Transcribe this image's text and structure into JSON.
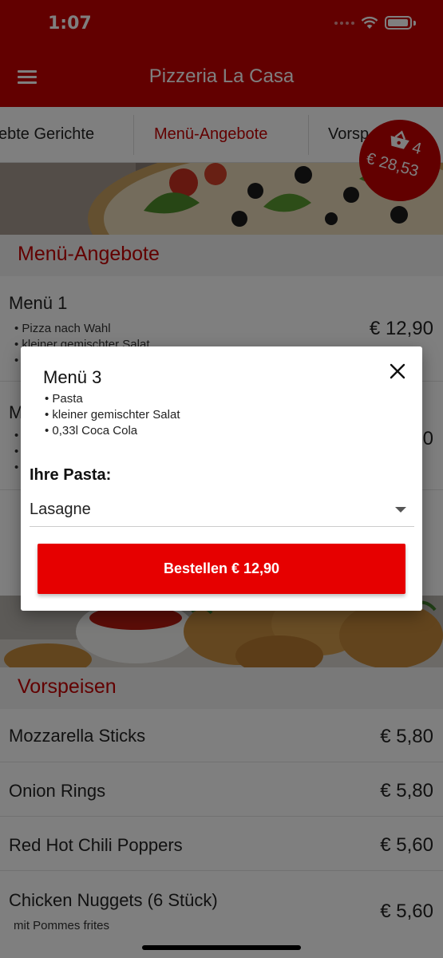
{
  "status_bar": {
    "time": "1:07"
  },
  "app_bar": {
    "title": "Pizzeria La Casa"
  },
  "tabs": [
    {
      "label": "ebte Gerichte"
    },
    {
      "label": "Menü-Angebote",
      "active": true
    },
    {
      "label": "Vorsp"
    }
  ],
  "cart": {
    "count": "4",
    "total": "€ 28,53"
  },
  "menu_section": {
    "title": "Menü-Angebote",
    "items": [
      {
        "title": "Menü 1",
        "bullets": [
          "• Pizza nach Wahl",
          "• kleiner gemischter Salat",
          "•"
        ],
        "price": "€ 12,90"
      },
      {
        "title": "M",
        "bullets": [
          "•",
          "•",
          "•"
        ],
        "price": "0"
      }
    ]
  },
  "starters_section": {
    "title": "Vorspeisen",
    "items": [
      {
        "title": "Mozzarella Sticks",
        "price": "€ 5,80"
      },
      {
        "title": "Onion Rings",
        "price": "€ 5,80"
      },
      {
        "title": "Red Hot Chili Poppers",
        "price": "€ 5,60"
      },
      {
        "title": "Chicken Nuggets (6 Stück)",
        "subtitle": "mit Pommes frites",
        "price": "€ 5,60"
      }
    ]
  },
  "dialog": {
    "title": "Menü 3",
    "bullets": [
      "• Pasta",
      "• kleiner gemischter Salat",
      "• 0,33l Coca Cola"
    ],
    "select_label": "Ihre Pasta:",
    "select_value": "Lasagne",
    "order_button": "Bestellen € 12,90"
  },
  "colors": {
    "brand": "#c40000",
    "button": "#e60000"
  }
}
